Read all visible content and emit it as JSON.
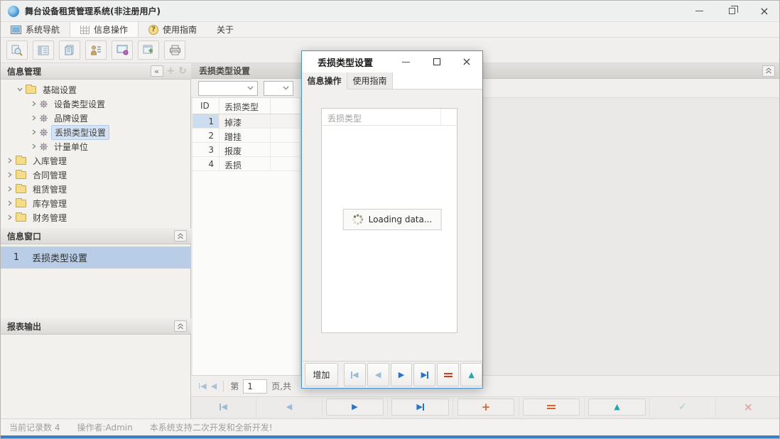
{
  "window": {
    "title": "舞台设备租赁管理系统(非注册用户)"
  },
  "menu": {
    "items": [
      {
        "label": "系统导航",
        "icon": "window-icon"
      },
      {
        "label": "信息操作",
        "icon": "grid-icon"
      },
      {
        "label": "使用指南",
        "icon": "help-icon"
      },
      {
        "label": "关于",
        "icon": ""
      }
    ]
  },
  "toolbar": {
    "buttons": [
      "search",
      "form-view",
      "document",
      "user-tasks",
      "monitor-browse",
      "add-window",
      "printer"
    ]
  },
  "sidebar": {
    "info_panel_title": "信息管理",
    "tree": {
      "root": {
        "label": "基础设置"
      },
      "children": [
        {
          "label": "设备类型设置"
        },
        {
          "label": "品牌设置"
        },
        {
          "label": "丢损类型设置",
          "selected": true
        },
        {
          "label": "计量单位"
        }
      ],
      "folders": [
        {
          "label": "入库管理"
        },
        {
          "label": "合同管理"
        },
        {
          "label": "租赁管理"
        },
        {
          "label": "库存管理"
        },
        {
          "label": "财务管理"
        }
      ]
    },
    "window_panel": {
      "title": "信息窗口",
      "items": [
        {
          "index": "1",
          "label": "丢损类型设置"
        }
      ]
    },
    "report_panel_title": "报表输出"
  },
  "main": {
    "header_title": "丢损类型设置",
    "table": {
      "columns": [
        {
          "label": "ID"
        },
        {
          "label": "丢损类型"
        }
      ],
      "rows": [
        {
          "id": "1",
          "type": "掉漆"
        },
        {
          "id": "2",
          "type": "蹭挂"
        },
        {
          "id": "3",
          "type": "报废"
        },
        {
          "id": "4",
          "type": "丢损"
        }
      ]
    },
    "pager": {
      "page_label": "第",
      "page_value": "1",
      "page_suffix": "页,共"
    }
  },
  "statusbar": {
    "record_count": "当前记录数 4",
    "operator": "操作者:Admin",
    "message": "本系统支持二次开发和全新开发!"
  },
  "dialog": {
    "title": "丢损类型设置",
    "tabs": [
      {
        "label": "信息操作"
      },
      {
        "label": "使用指南"
      }
    ],
    "grid_header": "丢损类型",
    "loading_text": "Loading data...",
    "add_button_label": "增加"
  },
  "colors": {
    "accent_blue": "#2473cf",
    "dialog_border": "#4a91d4",
    "selection_blue": "#b9cde6",
    "orange": "#d84f20",
    "teal": "#2aa5a8",
    "check_green": "#a9d3a9",
    "cross_red": "#e4a29a"
  }
}
